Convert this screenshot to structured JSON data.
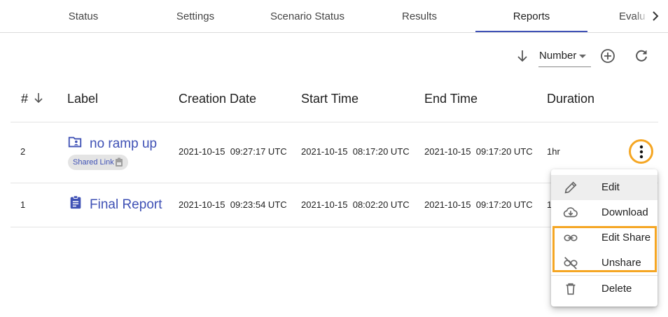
{
  "tabs": [
    {
      "label": "Status",
      "active": false
    },
    {
      "label": "Settings",
      "active": false
    },
    {
      "label": "Scenario Status",
      "active": false
    },
    {
      "label": "Results",
      "active": false
    },
    {
      "label": "Reports",
      "active": true
    },
    {
      "label": "Evalu",
      "active": false
    }
  ],
  "toolbar": {
    "sort_field": "Number",
    "sort_direction_icon": "arrow-down-icon",
    "add_icon": "add-circle-icon",
    "refresh_icon": "refresh-icon"
  },
  "table": {
    "columns": [
      "#",
      "Label",
      "Creation Date",
      "Start Time",
      "End Time",
      "Duration"
    ],
    "rows": [
      {
        "number": "2",
        "label": "no ramp up",
        "icon": "shared-folder-icon",
        "chip": "Shared Link",
        "creation_date": "2021-10-15  09:27:17 UTC",
        "start_time": "2021-10-15  08:17:20 UTC",
        "end_time": "2021-10-15  09:17:20 UTC",
        "duration": "1hr"
      },
      {
        "number": "1",
        "label": "Final Report",
        "icon": "clipboard-icon",
        "creation_date": "2021-10-15  09:23:54 UTC",
        "start_time": "2021-10-15  08:02:20 UTC",
        "end_time": "2021-10-15  09:17:20 UTC",
        "duration": "1"
      }
    ]
  },
  "menu": {
    "items": [
      {
        "label": "Edit",
        "icon": "pencil-icon"
      },
      {
        "label": "Download",
        "icon": "cloud-download-icon"
      },
      {
        "label": "Edit Share",
        "icon": "link-icon"
      },
      {
        "label": "Unshare",
        "icon": "link-off-icon"
      },
      {
        "label": "Delete",
        "icon": "trash-icon"
      }
    ]
  },
  "colors": {
    "accent": "#3f51b5",
    "highlight": "#f5a623",
    "icon_gray": "#666666"
  }
}
